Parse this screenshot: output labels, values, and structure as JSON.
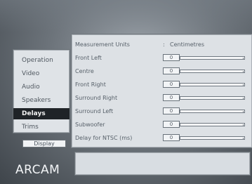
{
  "menu": {
    "items": [
      {
        "label": "Operation",
        "selected": false
      },
      {
        "label": "Video",
        "selected": false
      },
      {
        "label": "Audio",
        "selected": false
      },
      {
        "label": "Speakers",
        "selected": false
      },
      {
        "label": "Delays",
        "selected": true
      },
      {
        "label": "Trims",
        "selected": false
      }
    ],
    "display_button": "Display"
  },
  "brand": {
    "logo": "ARCAM"
  },
  "panel": {
    "units": {
      "label": "Measurement Units",
      "separator": ":",
      "value": "Centimetres"
    },
    "rows": [
      {
        "label": "Front Left",
        "value": "0"
      },
      {
        "label": "Centre",
        "value": "0"
      },
      {
        "label": "Front Right",
        "value": "0"
      },
      {
        "label": "Surround Right",
        "value": "0"
      },
      {
        "label": "Surround Left",
        "value": "0"
      },
      {
        "label": "Subwoofer",
        "value": "0"
      },
      {
        "label": "Delay for NTSC (ms)",
        "value": "0"
      }
    ]
  },
  "colors": {
    "panel_bg": "#dde1e5",
    "selected_bg": "#1f2327",
    "text": "#58616a",
    "brand": "#f3f5f7"
  }
}
